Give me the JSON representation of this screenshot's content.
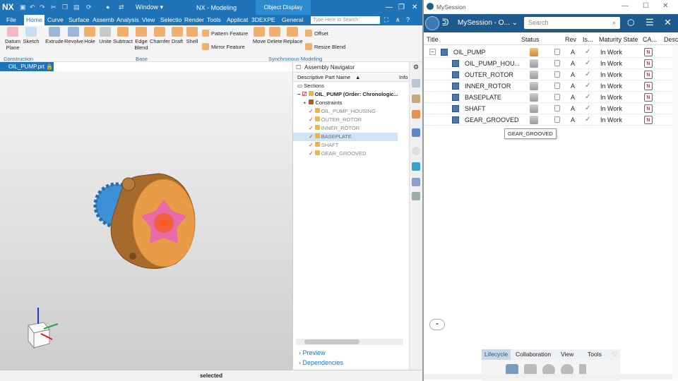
{
  "nx": {
    "logo": "NX",
    "window_menu": "Window",
    "title": "NX - Modeling",
    "object_display": "Object Display",
    "search_placeholder": "Type Here to Search",
    "tabs": [
      "File",
      "Home",
      "Curve",
      "Surface",
      "Assemb",
      "Analysis",
      "View",
      "Selectio",
      "Render",
      "Tools",
      "Applicat",
      "3DEXPE",
      "General"
    ],
    "active_tab": "Home",
    "tools": [
      "Datum Plane",
      "Sketch",
      "Extrude",
      "Revolve",
      "Hole",
      "Unite",
      "Subtract",
      "Edge Blend",
      "Chamfer",
      "Draft",
      "Shell"
    ],
    "small_tools": [
      "Pattern Feature",
      "Mirror Feature",
      "Move",
      "Delete",
      "Replace",
      "Offset",
      "Resize Blend"
    ],
    "groups": {
      "construction": "Construction",
      "base": "Base",
      "sync": "Synchronous Modeling"
    },
    "doc_tab": "OIL_PUMP.prt",
    "status": "selected",
    "colors": {
      "accent": "#1f73b7",
      "part_bronze": "#a66a2c",
      "part_blue": "#3d8fd6",
      "part_orange": "#f0a24a",
      "part_pink": "#e86aa8"
    }
  },
  "navigator": {
    "title": "Assembly Navigator",
    "col_name": "Descriptive Part Name",
    "col_info": "Info",
    "sections": "Sections",
    "root": "OIL_PUMP (Order: Chronologic...",
    "constraints": "Constraints",
    "parts": [
      "OIL_PUMP_HOUSING",
      "OUTER_ROTOR",
      "INNER_ROTOR",
      "BASEPLATE",
      "SHAFT",
      "GEAR_GROOVED"
    ],
    "selected": "BASEPLATE",
    "preview": "Preview",
    "dependencies": "Dependencies"
  },
  "mysession": {
    "window_title": "MySession",
    "name": "MySession - O...",
    "search_placeholder": "Search",
    "columns": [
      "Title",
      "Status",
      "Rev",
      "Is...",
      "Maturity State",
      "CA...",
      "Desc"
    ],
    "root": {
      "title": "OIL_PUMP",
      "rev": "A",
      "state": "In Work"
    },
    "rows": [
      {
        "title": "OIL_PUMP_HOU...",
        "rev": "A",
        "state": "In Work"
      },
      {
        "title": "OUTER_ROTOR",
        "rev": "A",
        "state": "In Work"
      },
      {
        "title": "INNER_ROTOR",
        "rev": "A",
        "state": "In Work"
      },
      {
        "title": "BASEPLATE",
        "rev": "A",
        "state": "In Work"
      },
      {
        "title": "SHAFT",
        "rev": "A",
        "state": "In Work"
      },
      {
        "title": "GEAR_GROOVED",
        "rev": "A",
        "state": "In Work"
      }
    ],
    "tooltip": "GEAR_GROOVED",
    "bottom_tabs": [
      "Lifecycle",
      "Collaboration",
      "View",
      "Tools"
    ],
    "active_bottom_tab": "Lifecycle"
  }
}
